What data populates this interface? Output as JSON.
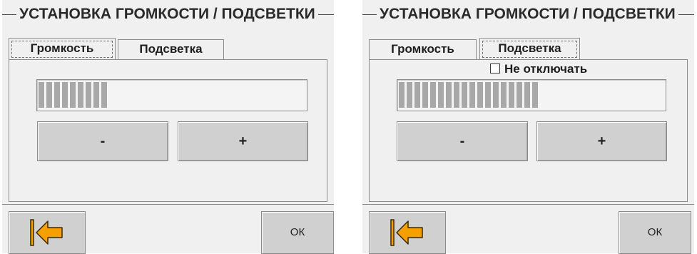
{
  "colors": {
    "panel_bg": "#f0f0f0",
    "button_bg": "#d0d0d0",
    "meter_bar": "#a8a8a8",
    "back_arrow": "#f5a000"
  },
  "icons": {
    "back": "back-to-start-arrow-icon",
    "checkbox": "checkbox-unchecked-icon"
  },
  "screens": [
    {
      "title": "УСТАНОВКА ГРОМКОСТИ / ПОДСВЕТКИ",
      "tabs": [
        {
          "label": "Громкость",
          "active": true
        },
        {
          "label": "Подсветка",
          "active": false
        }
      ],
      "level": {
        "segments_filled": 9,
        "segments_total": 35
      },
      "minus_label": "-",
      "plus_label": "+",
      "ok_label": "ОК"
    },
    {
      "title": "УСТАНОВКА ГРОМКОСТИ / ПОДСВЕТКИ",
      "tabs": [
        {
          "label": "Громкость",
          "active": false
        },
        {
          "label": "Подсветка",
          "active": true
        }
      ],
      "checkbox": {
        "label": "Не отключать",
        "checked": false
      },
      "level": {
        "segments_filled": 18,
        "segments_total": 35
      },
      "minus_label": "-",
      "plus_label": "+",
      "ok_label": "ОК"
    }
  ]
}
